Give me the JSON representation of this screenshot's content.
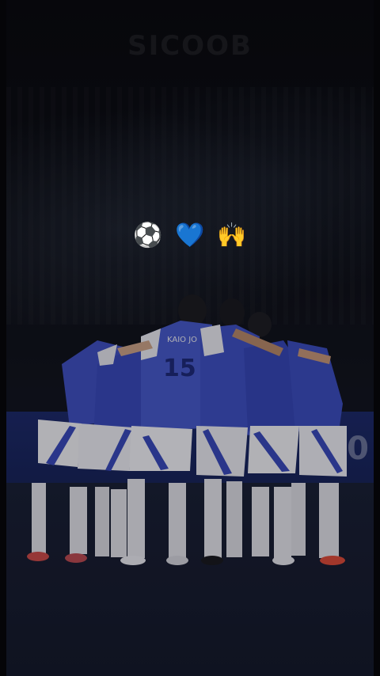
{
  "photo": {
    "sponsor_text": "SICOOB",
    "board_text": "00",
    "shirt_number": "15",
    "shirt_name": "KAIO JO"
  },
  "caption": {
    "emojis": [
      "⚽",
      "💙",
      "🙌"
    ]
  }
}
